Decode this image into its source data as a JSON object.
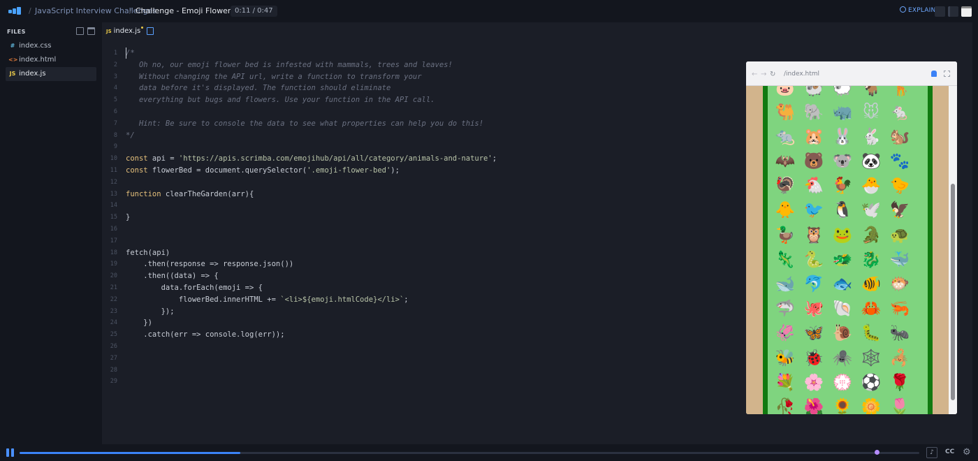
{
  "breadcrumb": {
    "parent": "JavaScript Interview Challenges",
    "current": "Challenge - Emoji Flower Bed",
    "timer": "0:11 / 0:47"
  },
  "header": {
    "explain_label": "EXPLAIN",
    "accent": "#3b82f6"
  },
  "sidebar": {
    "title": "FILES",
    "files": [
      {
        "type": "#",
        "name": "index.css",
        "icon": "css-file-icon"
      },
      {
        "type": "<>",
        "name": "index.html",
        "icon": "html-file-icon"
      },
      {
        "type": "JS",
        "name": "index.js",
        "icon": "js-file-icon",
        "active": true
      }
    ]
  },
  "editor": {
    "tab_label": "index.js",
    "tab_type": "JS",
    "line_numbers": [
      "1",
      "2",
      "3",
      "4",
      "5",
      "6",
      "7",
      "8",
      "9",
      "10",
      "11",
      "12",
      "13",
      "14",
      "15",
      "16",
      "17",
      "18",
      "19",
      "20",
      "21",
      "22",
      "23",
      "24",
      "25",
      "26",
      "27",
      "28",
      "29"
    ],
    "lines": [
      [
        [
          "cm",
          "/*"
        ]
      ],
      [
        [
          "cm",
          "   Oh no, our emoji flower bed is infested with mammals, trees and leaves!"
        ]
      ],
      [
        [
          "cm",
          "   Without changing the API url, write a function to transform your"
        ]
      ],
      [
        [
          "cm",
          "   data before it's displayed. The function should eliminate"
        ]
      ],
      [
        [
          "cm",
          "   everything but bugs and flowers. Use your function in the API call."
        ]
      ],
      [],
      [
        [
          "cm",
          "   Hint: Be sure to console the data to see what properties can help you do this!"
        ]
      ],
      [
        [
          "cm",
          "*/"
        ]
      ],
      [],
      [
        [
          "kw",
          "const"
        ],
        [
          "pl",
          " api = "
        ],
        [
          "str",
          "'https://apis.scrimba.com/emojihub/api/all/category/animals-and-nature'"
        ],
        [
          "pl",
          ";"
        ]
      ],
      [
        [
          "kw",
          "const"
        ],
        [
          "pl",
          " flowerBed = document.querySelector("
        ],
        [
          "str",
          "'.emoji-flower-bed'"
        ],
        [
          "pl",
          ");"
        ]
      ],
      [],
      [
        [
          "kw",
          "function"
        ],
        [
          "pl",
          " clearTheGarden(arr){"
        ]
      ],
      [],
      [
        [
          "pl",
          "}"
        ]
      ],
      [],
      [],
      [
        [
          "pl",
          "fetch(api)"
        ]
      ],
      [
        [
          "pl",
          "    .then(response => response.json())"
        ]
      ],
      [
        [
          "pl",
          "    .then((data) => {"
        ]
      ],
      [
        [
          "pl",
          "        data.forEach(emoji => {"
        ]
      ],
      [
        [
          "pl",
          "            flowerBed.innerHTML += "
        ],
        [
          "str",
          "`<li>${emoji.htmlCode}</li>`"
        ],
        [
          "pl",
          ";"
        ]
      ],
      [
        [
          "pl",
          "        });"
        ]
      ],
      [
        [
          "pl",
          "    })"
        ]
      ],
      [
        [
          "pl",
          "    .catch(err => console.log(err));"
        ]
      ],
      [],
      [],
      [],
      []
    ]
  },
  "preview": {
    "url": "/index.html",
    "bed_colors": {
      "soil": "#d2b48c",
      "border": "#117a11",
      "grass": "#7fd47f"
    },
    "emojis": [
      "🐷",
      "🐏",
      "🐑",
      "🐐",
      "🦒",
      "🐫",
      "🐘",
      "🦏",
      "🐭",
      "🐁",
      "🐀",
      "🐹",
      "🐰",
      "🐇",
      "🐿️",
      "🦇",
      "🐻",
      "🐨",
      "🐼",
      "🐾",
      "🦃",
      "🐔",
      "🐓",
      "🐣",
      "🐤",
      "🐥",
      "🐦",
      "🐧",
      "🕊️",
      "🦅",
      "🦆",
      "🦉",
      "🐸",
      "🐊",
      "🐢",
      "🦎",
      "🐍",
      "🐲",
      "🐉",
      "🐳",
      "🐋",
      "🐬",
      "🐟",
      "🐠",
      "🐡",
      "🦈",
      "🐙",
      "🐚",
      "🦀",
      "🦐",
      "🦑",
      "🦋",
      "🐌",
      "🐛",
      "🐜",
      "🐝",
      "🐞",
      "🕷️",
      "🕸️",
      "🦂",
      "💐",
      "🌸",
      "💮",
      "⚽",
      "🌹",
      "🥀",
      "🌺",
      "🌻",
      "🌼",
      "🌷"
    ]
  },
  "player": {
    "progress": 0.245,
    "cc_label": "CC"
  }
}
